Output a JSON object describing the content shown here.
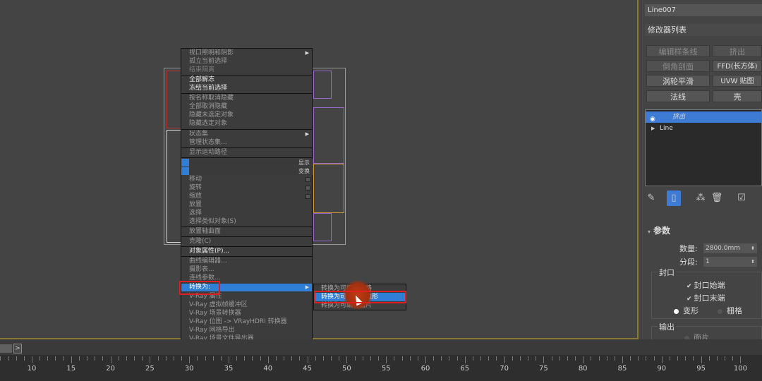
{
  "quad_menu": {
    "items": [
      {
        "label": "视口照明和阴影",
        "has_sub": true
      },
      {
        "label": "孤立当前选择"
      },
      {
        "label": "结束隔离"
      },
      {
        "label": "全部解冻"
      },
      {
        "label": "冻结当前选择"
      },
      {
        "label": "按名称取消隐藏"
      },
      {
        "label": "全部取消隐藏"
      },
      {
        "label": "隐藏未选定对象"
      },
      {
        "label": "隐藏选定对象"
      },
      {
        "label": "状态集",
        "has_sub": true
      },
      {
        "label": "管理状态集..."
      },
      {
        "label": "显示运动路径"
      }
    ],
    "quad_labels": {
      "display": "显示",
      "transform": "变换"
    },
    "transform_items": [
      {
        "label": "移动"
      },
      {
        "label": "旋转"
      },
      {
        "label": "缩放"
      },
      {
        "label": "放置"
      },
      {
        "label": "选择"
      },
      {
        "label": "选择类似对象(S)"
      },
      {
        "label": "放置轴曲面"
      },
      {
        "label": "克隆(C)"
      },
      {
        "label": "对象属性(P)..."
      },
      {
        "label": "曲线编辑器..."
      },
      {
        "label": "摄影表..."
      },
      {
        "label": "连线参数..."
      },
      {
        "label": "转换为:"
      },
      {
        "label": "V-Ray 属性"
      },
      {
        "label": "V-Ray 虚拟帧缓冲区"
      },
      {
        "label": "V-Ray 场景转换器"
      },
      {
        "label": "V-Ray 位图 -> VRayHDRI 转换器"
      },
      {
        "label": "V-Ray 网格导出"
      },
      {
        "label": "V-Ray 场景文件导出器"
      }
    ]
  },
  "submenu": {
    "items": [
      {
        "label": "转换为可编辑网格"
      },
      {
        "label": "转换为可编辑多边形"
      },
      {
        "label": "转换为可编辑面片"
      }
    ]
  },
  "panel": {
    "object_name": "Line007",
    "modifier_list": "修改器列表",
    "buttons": [
      {
        "label": "编辑样条线",
        "on": false
      },
      {
        "label": "挤出",
        "on": false
      },
      {
        "label": "倒角剖面",
        "on": false
      },
      {
        "label": "FFD(长方体)",
        "on": true
      },
      {
        "label": "涡轮平滑",
        "on": true
      },
      {
        "label": "UVW 贴图",
        "on": true
      },
      {
        "label": "法线",
        "on": true
      },
      {
        "label": "壳",
        "on": true
      }
    ],
    "stack": [
      {
        "label": "挤出",
        "selected": true
      },
      {
        "label": "Line",
        "selected": false
      }
    ],
    "params": {
      "header": "参数",
      "amount_label": "数量:",
      "amount_value": "2800.0mm",
      "segments_label": "分段:",
      "segments_value": "1",
      "capping_label": "封口",
      "cap_start": "封口始端",
      "cap_end": "封口末端",
      "morph": "变形",
      "grid": "栅格",
      "output_label": "输出",
      "output_item": "面片"
    }
  },
  "timeline": {
    "ticks": [
      "10",
      "15",
      "20",
      "25",
      "30",
      "35",
      "40",
      "45",
      "50",
      "55",
      "60",
      "65",
      "70",
      "75",
      "80",
      "85",
      "90",
      "95",
      "100"
    ]
  },
  "colors": {
    "accent": "#2f7fd6",
    "highlight": "#e02020",
    "viewport_border": "#8a7a3a"
  }
}
